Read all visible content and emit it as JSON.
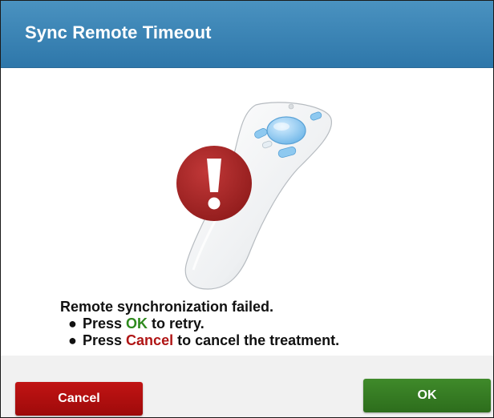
{
  "dialog": {
    "title": "Sync Remote Timeout",
    "message": {
      "heading": "Remote synchronization failed.",
      "bullets": [
        {
          "prefix": "Press ",
          "keyword": "OK",
          "suffix": " to retry."
        },
        {
          "prefix": "Press ",
          "keyword": "Cancel",
          "suffix": " to cancel the treatment."
        }
      ]
    },
    "buttons": {
      "cancel_label": "Cancel",
      "ok_label": "OK"
    },
    "illustration": {
      "remote_icon": "remote-control-icon",
      "alert_icon": "exclamation-alert-icon"
    }
  },
  "colors": {
    "title_bar": "#3a86b8",
    "ok_accent": "#2e8a1e",
    "cancel_accent": "#b01515",
    "alert_circle": "#a12424",
    "remote_buttons": "#8ec9f0"
  }
}
